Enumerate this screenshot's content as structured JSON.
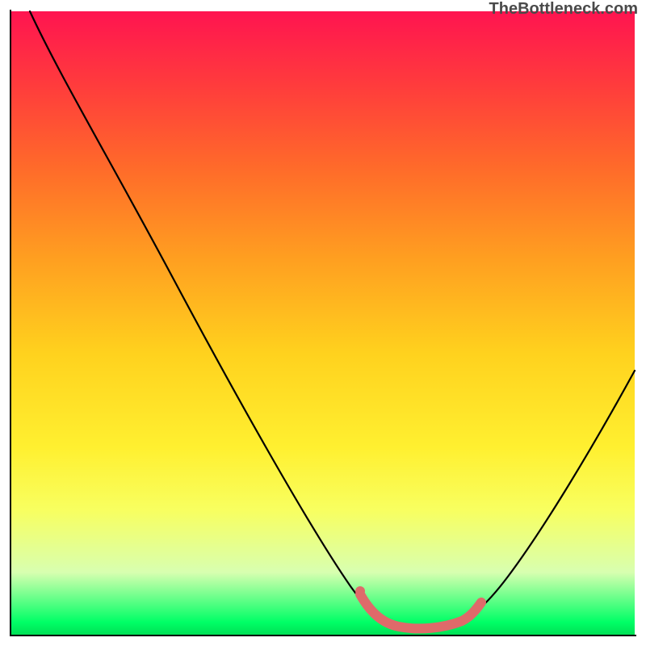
{
  "watermark": "TheBottleneck.com",
  "chart_data": {
    "type": "line",
    "title": "",
    "xlabel": "",
    "ylabel": "",
    "xlim": [
      0,
      100
    ],
    "ylim": [
      0,
      100
    ],
    "background_gradient": {
      "top": "#ff1450",
      "bottom": "#00e055",
      "stops": [
        "#ff1450",
        "#ff3c3c",
        "#ff6a2a",
        "#ffa020",
        "#ffd21e",
        "#fff030",
        "#f8ff60",
        "#d8ffb0",
        "#00ff66",
        "#00e055"
      ]
    },
    "series": [
      {
        "name": "main-curve",
        "color": "#000000",
        "x": [
          3,
          10,
          20,
          30,
          40,
          50,
          55,
          58,
          60,
          63,
          68,
          72,
          78,
          85,
          92,
          100
        ],
        "y": [
          100,
          87,
          70,
          53,
          36,
          18,
          9,
          4,
          2,
          1,
          1,
          2,
          8,
          20,
          35,
          55
        ]
      },
      {
        "name": "highlight-band",
        "color": "#e06a6a",
        "x": [
          56,
          60,
          64,
          68,
          72,
          74
        ],
        "y": [
          6,
          2,
          1,
          1,
          2,
          4
        ]
      }
    ],
    "annotations": []
  }
}
